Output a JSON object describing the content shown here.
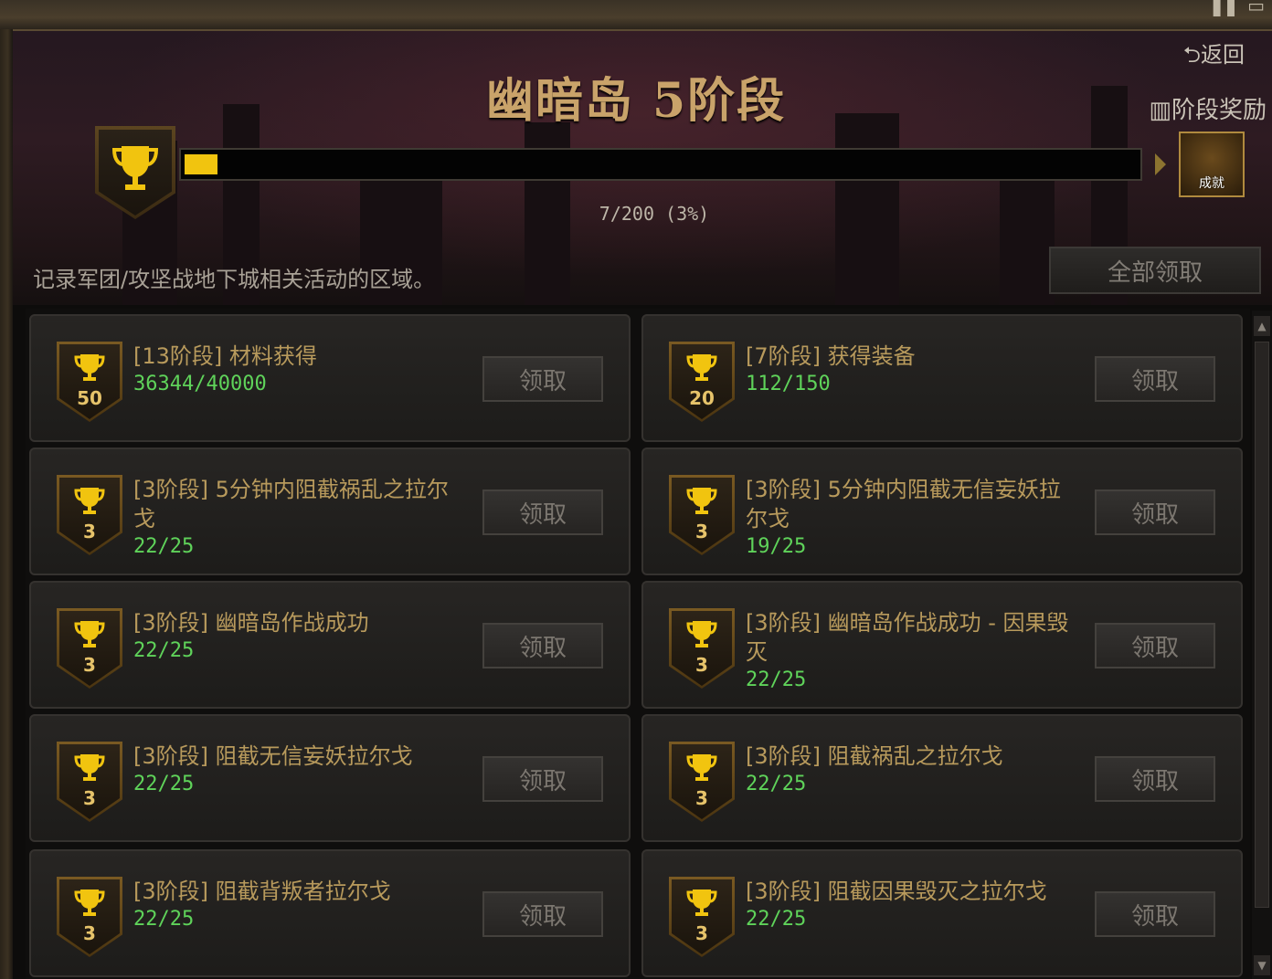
{
  "header": {
    "title": "幽暗岛 5阶段",
    "back_label": "⮌返回",
    "stage_reward_label": "阶段奖励",
    "chest_label": "成就",
    "progress_text": "7/200 (3%)",
    "progress_fraction": 0.03,
    "description": "记录军团/攻坚战地下城相关活动的区域。",
    "claim_all_label": "全部领取"
  },
  "achievements": [
    {
      "points": "50",
      "title": "[13阶段] 材料获得",
      "count": "36344/40000",
      "button": "领取"
    },
    {
      "points": "20",
      "title": "[7阶段] 获得装备",
      "count": "112/150",
      "button": "领取"
    },
    {
      "points": "3",
      "title": "[3阶段] 5分钟内阻截祸乱之拉尔戈",
      "count": "22/25",
      "button": "领取"
    },
    {
      "points": "3",
      "title": "[3阶段] 5分钟内阻截无信妄妖拉尔戈",
      "count": "19/25",
      "button": "领取"
    },
    {
      "points": "3",
      "title": "[3阶段] 幽暗岛作战成功",
      "count": "22/25",
      "button": "领取"
    },
    {
      "points": "3",
      "title": "[3阶段] 幽暗岛作战成功 - 因果毁灭",
      "count": "22/25",
      "button": "领取"
    },
    {
      "points": "3",
      "title": "[3阶段] 阻截无信妄妖拉尔戈",
      "count": "22/25",
      "button": "领取"
    },
    {
      "points": "3",
      "title": "[3阶段] 阻截祸乱之拉尔戈",
      "count": "22/25",
      "button": "领取"
    },
    {
      "points": "3",
      "title": "[3阶段] 阻截背叛者拉尔戈",
      "count": "22/25",
      "button": "领取"
    },
    {
      "points": "3",
      "title": "[3阶段] 阻截因果毁灭之拉尔戈",
      "count": "22/25",
      "button": "领取"
    }
  ],
  "colors": {
    "progress_fill": "#f1c40f",
    "count_text": "#5fd35a",
    "title_text": "#b89a5c"
  }
}
